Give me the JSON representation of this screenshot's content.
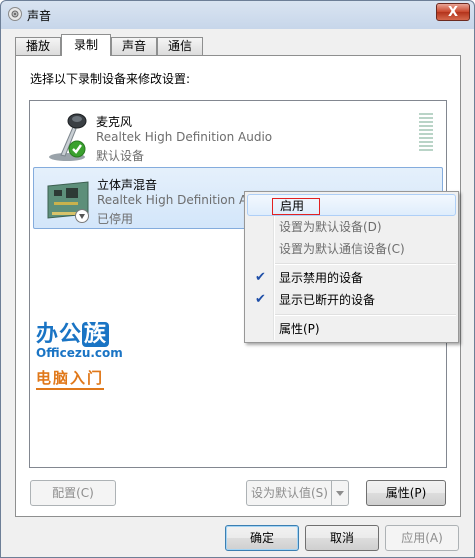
{
  "window": {
    "title": "声音",
    "close_label": "X"
  },
  "tabs": [
    {
      "label": "播放",
      "active": false
    },
    {
      "label": "录制",
      "active": true
    },
    {
      "label": "声音",
      "active": false
    },
    {
      "label": "通信",
      "active": false
    }
  ],
  "instruction": "选择以下录制设备来修改设置:",
  "devices": [
    {
      "name": "麦克风",
      "driver": "Realtek High Definition Audio",
      "status": "默认设备",
      "icon": "microphone-icon",
      "badge": "default-check"
    },
    {
      "name": "立体声混音",
      "driver": "Realtek High Definition Audio",
      "status": "已停用",
      "icon": "sound-card-icon",
      "badge": "disabled-arrow"
    }
  ],
  "context_menu": [
    {
      "label": "启用",
      "enabled": true,
      "checked": false
    },
    {
      "label": "设置为默认设备(D)",
      "enabled": false,
      "checked": false
    },
    {
      "label": "设置为默认通信设备(C)",
      "enabled": false,
      "checked": false
    },
    {
      "label": "显示禁用的设备",
      "enabled": true,
      "checked": true
    },
    {
      "label": "显示已断开的设备",
      "enabled": true,
      "checked": true
    },
    {
      "label": "属性(P)",
      "enabled": true,
      "checked": false
    }
  ],
  "watermark": {
    "line1_a": "办公",
    "line1_b": "族",
    "line2": "Officezu.com",
    "line3": "电脑入门"
  },
  "panel_buttons": {
    "configure": "配置(C)",
    "set_default": "设为默认值(S)",
    "properties": "属性(P)"
  },
  "dialog_buttons": {
    "ok": "确定",
    "cancel": "取消",
    "apply": "应用(A)"
  },
  "colors": {
    "accent": "#1a74c4",
    "selection": "#d3e6fa",
    "check": "#1f4fa8",
    "highlight_box": "#e22121"
  }
}
